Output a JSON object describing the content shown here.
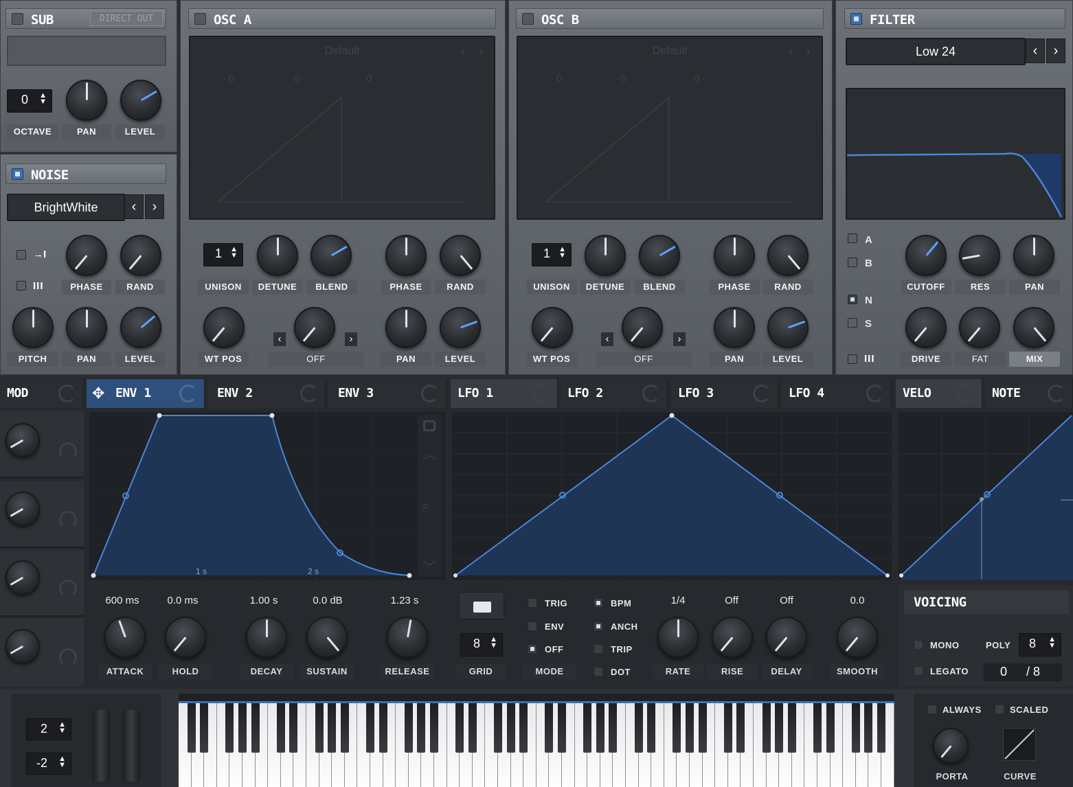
{
  "sub": {
    "title": "SUB",
    "direct_out": "DIRECT OUT",
    "octave": "0",
    "octave_label": "OCTAVE",
    "pan_label": "PAN",
    "level_label": "LEVEL"
  },
  "noise": {
    "title": "NOISE",
    "preset": "BrightWhite",
    "phase_label": "PHASE",
    "rand_label": "RAND",
    "pitch_label": "PITCH",
    "pan_label": "PAN",
    "level_label": "LEVEL",
    "retrig_glyph": "→I",
    "keytrack_glyph": "III"
  },
  "osc_a": {
    "title": "OSC A",
    "wavetable": "Default",
    "unison": "1",
    "unison_label": "UNISON",
    "detune_label": "DETUNE",
    "blend_label": "BLEND",
    "phase_label": "PHASE",
    "rand_label": "RAND",
    "wtpos_label": "WT POS",
    "warp": "OFF",
    "pan_label": "PAN",
    "level_label": "LEVEL",
    "scale_nums": [
      "0",
      "0",
      "0"
    ]
  },
  "osc_b": {
    "title": "OSC B",
    "wavetable": "Default",
    "unison": "1",
    "unison_label": "UNISON",
    "detune_label": "DETUNE",
    "blend_label": "BLEND",
    "phase_label": "PHASE",
    "rand_label": "RAND",
    "wtpos_label": "WT POS",
    "warp": "OFF",
    "pan_label": "PAN",
    "level_label": "LEVEL",
    "scale_nums": [
      "0",
      "0",
      "0"
    ]
  },
  "filter": {
    "title": "FILTER",
    "type": "Low 24",
    "route_a": "A",
    "route_b": "B",
    "route_n": "N",
    "route_s": "S",
    "keytrack_glyph": "III",
    "cutoff_label": "CUTOFF",
    "res_label": "RES",
    "pan_label": "PAN",
    "drive_label": "DRIVE",
    "fat_label": "FAT",
    "mix_label": "MIX"
  },
  "tabs": {
    "mod": "MOD",
    "env1": "ENV 1",
    "env2": "ENV 2",
    "env3": "ENV 3",
    "lfo1": "LFO 1",
    "lfo2": "LFO 2",
    "lfo3": "LFO 3",
    "lfo4": "LFO 4",
    "velo": "VELO",
    "note": "NOTE"
  },
  "env": {
    "time_marks": [
      "1 s",
      "2 s"
    ],
    "attack": "600 ms",
    "hold": "0.0 ms",
    "decay": "1.00 s",
    "sustain": "0.0 dB",
    "release": "1.23 s",
    "attack_label": "ATTACK",
    "hold_label": "HOLD",
    "decay_label": "DECAY",
    "sustain_label": "SUSTAIN",
    "release_label": "RELEASE"
  },
  "lfo": {
    "grid": "8",
    "grid_label": "GRID",
    "mode_label": "MODE",
    "trig": "TRIG",
    "env": "ENV",
    "off": "OFF",
    "bpm": "BPM",
    "anch": "ANCH",
    "trip": "TRIP",
    "dot": "DOT",
    "rate": "1/4",
    "rise": "Off",
    "delay": "Off",
    "smooth": "0.0",
    "rate_label": "RATE",
    "rise_label": "RISE",
    "delay_label": "DELAY",
    "smooth_label": "SMOOTH"
  },
  "voicing": {
    "title": "VOICING",
    "mono": "MONO",
    "legato": "LEGATO",
    "poly_label": "POLY",
    "poly": "8",
    "voices": "0",
    "voices_max": "/ 8"
  },
  "keyboard": {
    "pitch_up": "2",
    "pitch_down": "-2",
    "always": "ALWAYS",
    "scaled": "SCALED",
    "porta_label": "PORTA",
    "curve_label": "CURVE"
  },
  "colors": {
    "accent": "#3d6fb0",
    "graph_line": "#4a86d6",
    "graph_fill": "#1f3556"
  }
}
